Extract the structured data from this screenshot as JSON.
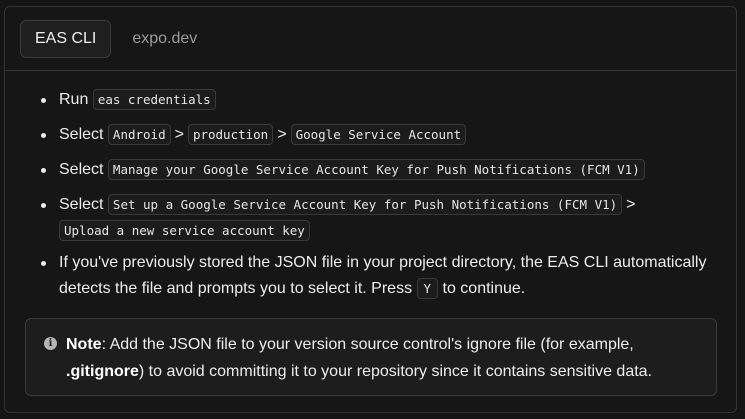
{
  "tabs": [
    {
      "label": "EAS CLI",
      "active": true
    },
    {
      "label": "expo.dev",
      "active": false
    }
  ],
  "steps": {
    "s1": {
      "prefix": "Run",
      "code": "eas credentials"
    },
    "s2": {
      "prefix": "Select",
      "codes": [
        "Android",
        "production",
        "Google Service Account"
      ],
      "separator": ">"
    },
    "s3": {
      "prefix": "Select",
      "code": "Manage your Google Service Account Key for Push Notifications (FCM V1)"
    },
    "s4": {
      "prefix": "Select",
      "codes": [
        "Set up a Google Service Account Key for Push Notifications (FCM V1)",
        "Upload a new service account key"
      ],
      "separator": ">"
    },
    "s5": {
      "text_before": "If you've previously stored the JSON file in your project directory, the EAS CLI automatically detects the file and prompts you to select it. Press",
      "key": "Y",
      "text_after": "to continue."
    }
  },
  "note": {
    "icon": "info-icon",
    "label": "Note",
    "text_a": ": Add the JSON file to your version source control's ignore file (for example,",
    "filename": ".gitignore",
    "text_b": ") to avoid committing it to your repository since it contains sensitive data."
  }
}
